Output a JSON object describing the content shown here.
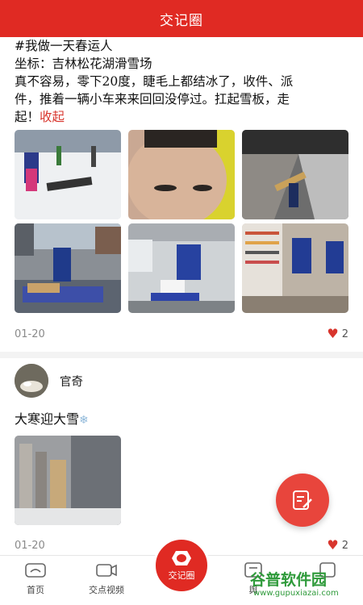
{
  "header": {
    "title": "交记圈"
  },
  "post1": {
    "lines": [
      "#我做一天春运人",
      "坐标：吉林松花湖滑雪场",
      "真不容易，零下20度，睫毛上都结冰了，收件、派",
      "件，推着一辆小车来来回回没停过。扛起雪板，走",
      "起！"
    ],
    "collapse_label": "收起",
    "date": "01-20",
    "likes": "2"
  },
  "post2": {
    "author": "官奇",
    "text": "大寒迎大雪",
    "emoji": "❄",
    "date": "01-20",
    "likes": "2"
  },
  "tabs": {
    "home": "首页",
    "video": "交点视频",
    "circle": "交记圈",
    "partial": "舆"
  },
  "watermark": {
    "main": "谷普软件园",
    "sub": "www.gupuxiazai.com"
  },
  "colors": {
    "brand_red": "#e02a23",
    "heart": "#d8352d",
    "watermark": "#2e9a3a"
  }
}
